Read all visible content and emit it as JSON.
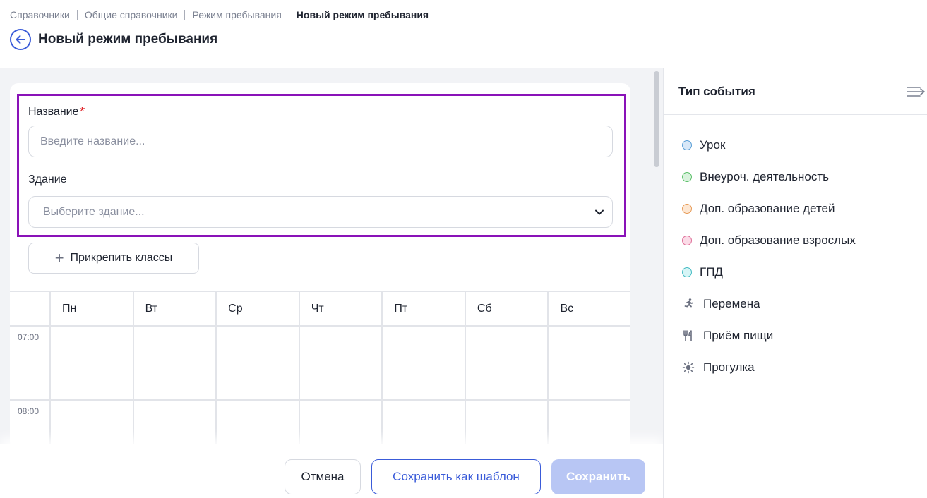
{
  "breadcrumb": [
    {
      "label": "Справочники"
    },
    {
      "label": "Общие справочники"
    },
    {
      "label": "Режим пребывания"
    },
    {
      "label": "Новый режим пребывания"
    }
  ],
  "page_title": "Новый режим пребывания",
  "form": {
    "name_label": "Название",
    "required_mark": "*",
    "name_placeholder": "Введите название...",
    "name_value": "",
    "building_label": "Здание",
    "building_placeholder": "Выберите здание..."
  },
  "attach_classes_label": "Прикрепить классы",
  "schedule": {
    "days": [
      "Пн",
      "Вт",
      "Ср",
      "Чт",
      "Пт",
      "Сб",
      "Вс"
    ],
    "times": [
      "07:00",
      "08:00"
    ]
  },
  "footer": {
    "cancel_label": "Отмена",
    "save_template_label": "Сохранить как шаблон",
    "save_label": "Сохранить"
  },
  "panel": {
    "title": "Тип события",
    "items": [
      {
        "label": "Урок",
        "icon": "dot",
        "color": "#a9cff0",
        "border": "#5a9fd6"
      },
      {
        "label": "Внеуроч. деятельность",
        "icon": "dot",
        "color": "#b9ebc0",
        "border": "#5cbf6a"
      },
      {
        "label": "Доп. образование детей",
        "icon": "dot",
        "color": "#fcd7b4",
        "border": "#e69a56"
      },
      {
        "label": "Доп. образование взрослых",
        "icon": "dot",
        "color": "#f8c2d6",
        "border": "#de6f98"
      },
      {
        "label": "ГПД",
        "icon": "dot",
        "color": "#b7eef0",
        "border": "#46bcc4"
      },
      {
        "label": "Перемена",
        "icon": "running-icon"
      },
      {
        "label": "Приём пищи",
        "icon": "fork-knife-icon"
      },
      {
        "label": "Прогулка",
        "icon": "sun-icon"
      }
    ]
  },
  "colors": {
    "accent": "#3a5bd9",
    "highlight_border": "#8a12b8",
    "required": "#e0252a",
    "save_disabled_bg": "#b8c6f4"
  }
}
